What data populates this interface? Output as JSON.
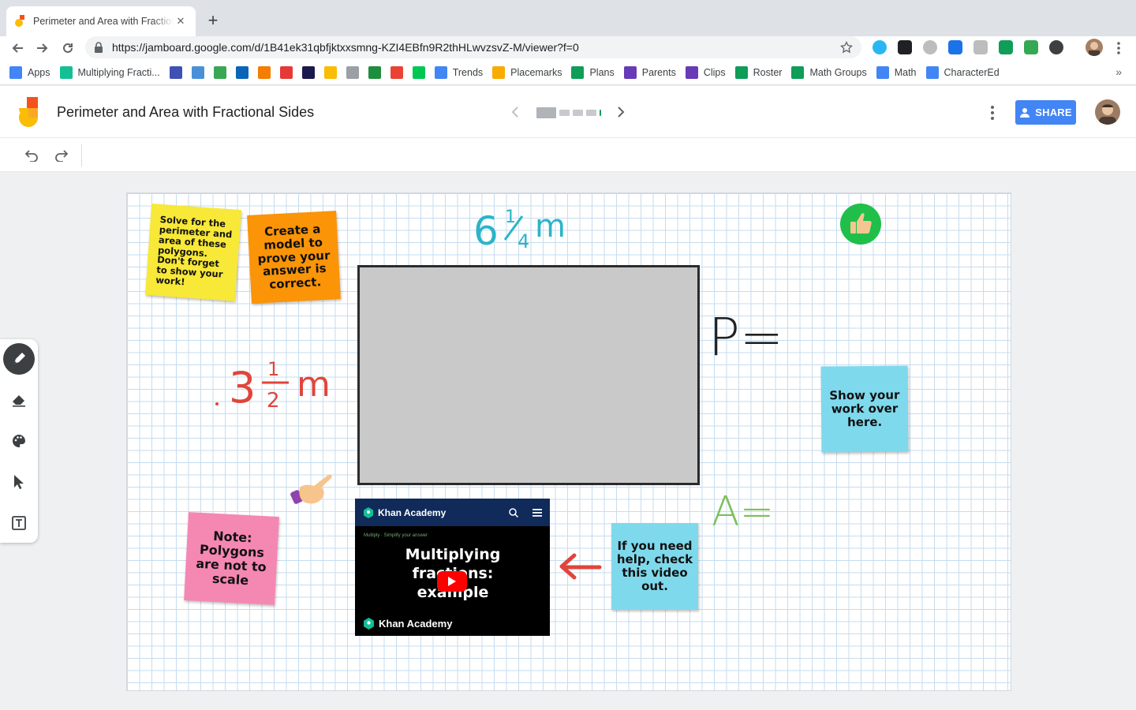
{
  "browser": {
    "tab_title": "Perimeter and Area with Fractional Sides",
    "url": "https://jamboard.google.com/d/1B41ek31qbfjktxxsmng-KZI4EBfn9R2thHLwvzsvZ-M/viewer?f=0",
    "bookmarks": [
      {
        "label": "Apps",
        "icon": "apps-grid-icon",
        "color": "#4285f4"
      },
      {
        "label": "Multiplying Fracti...",
        "icon": "khan-academy-icon",
        "color": "#14bf96"
      },
      {
        "label": "",
        "icon": "calendar-icon",
        "color": "#3f51b5"
      },
      {
        "label": "",
        "icon": "w-icon",
        "color": "#4a90d9"
      },
      {
        "label": "",
        "icon": "c-icon",
        "color": "#3aa757"
      },
      {
        "label": "",
        "icon": "outlook-icon",
        "color": "#0a64b8"
      },
      {
        "label": "",
        "icon": "blogger-icon",
        "color": "#f57d00"
      },
      {
        "label": "",
        "icon": "news-icon",
        "color": "#e53935"
      },
      {
        "label": "",
        "icon": "p-icon",
        "color": "#1a1a4e"
      },
      {
        "label": "",
        "icon": "drive-icon",
        "color": "#fbbc04"
      },
      {
        "label": "",
        "icon": "page-icon",
        "color": "#9aa0a6"
      },
      {
        "label": "",
        "icon": "classroom-icon",
        "color": "#1e8e3e"
      },
      {
        "label": "",
        "icon": "maps-pin-icon",
        "color": "#ea4335"
      },
      {
        "label": "",
        "icon": "plus-circle-icon",
        "color": "#00c853"
      },
      {
        "label": "Trends",
        "icon": "google-icon",
        "color": "#4285f4"
      },
      {
        "label": "Placemarks",
        "icon": "folder-icon",
        "color": "#f9ab00"
      },
      {
        "label": "Plans",
        "icon": "sheets-icon",
        "color": "#0f9d58"
      },
      {
        "label": "Parents",
        "icon": "forms-icon",
        "color": "#673ab7"
      },
      {
        "label": "Clips",
        "icon": "forms-icon",
        "color": "#673ab7"
      },
      {
        "label": "Roster",
        "icon": "sheets-icon",
        "color": "#0f9d58"
      },
      {
        "label": "Math Groups",
        "icon": "sheets-icon",
        "color": "#0f9d58"
      },
      {
        "label": "Math",
        "icon": "docs-icon",
        "color": "#4285f4"
      },
      {
        "label": "CharacterEd",
        "icon": "docs-icon",
        "color": "#4285f4"
      }
    ],
    "bookmarks_more": "»"
  },
  "app": {
    "title": "Perimeter and Area with Fractional Sides",
    "share_label": "SHARE",
    "frames": 5
  },
  "colors": {
    "accent": "#4285f4",
    "sticky_yellow": "#f8e838",
    "sticky_orange": "#fb9406",
    "sticky_pink": "#f587b3",
    "sticky_blue": "#7fd9ec",
    "ink_teal": "#2cb4c8",
    "ink_red": "#e0453c",
    "ink_black": "#222222",
    "ink_green": "#7cbf5a"
  },
  "board": {
    "stickies": {
      "instructions": "Solve for the perimeter and area of these polygons. Don't forget to show your work!",
      "model": "Create a model to prove your answer is correct.",
      "note": "Note: Polygons are not to scale",
      "show_work": "Show your work over here.",
      "help": "If you need help, check this video out."
    },
    "labels": {
      "top_whole": "6",
      "top_frac_num": "1",
      "top_frac_den": "4",
      "top_unit": "m",
      "side_whole": "3",
      "side_frac_num": "1",
      "side_frac_den": "2",
      "side_unit": "m",
      "perimeter": "P=",
      "area": "A="
    },
    "video": {
      "channel": "Khan Academy",
      "title": "Multiplying fractions: example",
      "subtitle": "Multiply  ·  Simplify your answer"
    }
  }
}
